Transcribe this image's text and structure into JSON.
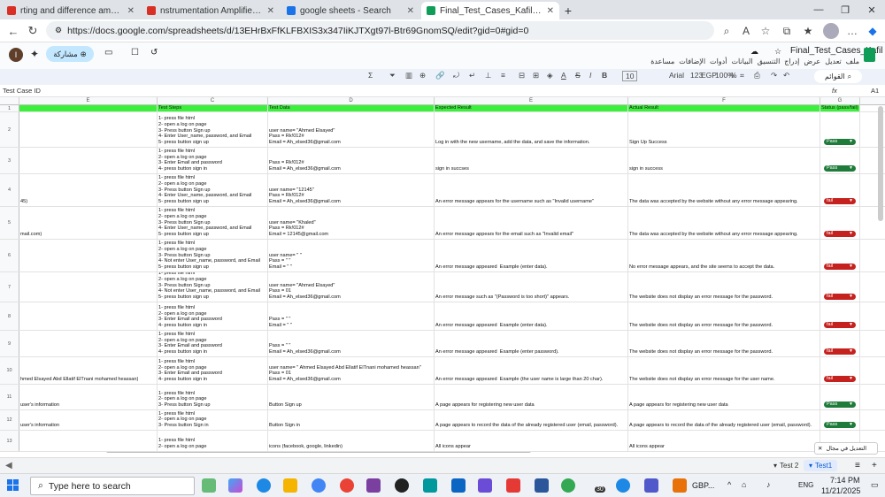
{
  "browser": {
    "tabs": [
      {
        "title": "rting and difference amp محاضرة",
        "icon_color": "#d93025",
        "active": false
      },
      {
        "title": "nstrumentation Amplifier محاضرة",
        "icon_color": "#d93025",
        "active": false
      },
      {
        "title": "google sheets - Search",
        "icon_color": "#1a73e8",
        "active": false
      },
      {
        "title": "Final_Test_Cases_Kafil - جداول بيانات",
        "icon_color": "#0f9d58",
        "active": true
      }
    ],
    "url": "https://docs.google.com/spreadsheets/d/13EHrBxFfKLFBXIS3x347IiKJTXgt97l-Btr69GnomSQ/edit?gid=0#gid=0"
  },
  "docs": {
    "title": "Final_Test_Cases_Kafil",
    "menu": [
      "ملف",
      "تعديل",
      "عرض",
      "إدراج",
      "التنسيق",
      "البيانات",
      "أدوات",
      "الإضافات",
      "مساعدة"
    ],
    "share_label": "مشاركة",
    "avatar_letter": "I",
    "menus_label": "القوائم",
    "zoom": "100%",
    "font": "Arial",
    "font_size": "10",
    "currency": "EGP",
    "number_format": "123",
    "cell_ref": "A1",
    "formula_value": "Test Case ID"
  },
  "grid": {
    "columns": [
      "E",
      "C",
      "D",
      "E",
      "F",
      "G"
    ],
    "header": {
      "steps": "Test Steps",
      "data": "Test Data",
      "expected": "Expected Result",
      "actual": "Actual Result",
      "status": "Status (pass/fail)"
    },
    "rows": [
      {
        "num": "2",
        "left": "",
        "steps": "1- press file html\n2- open a log on page\n3- Press button Sign up\n4- Enter User_name, password, and Email\n5- press button sign up",
        "data": "user name= \"Ahmed Elsayed\"\nPass = Rk!012#\nEmail = Ah_elsed36@gmail.com",
        "expected": "Log in with the new username, add the data, and save the information.",
        "actual": "Sign Up Success",
        "status": "Pass"
      },
      {
        "num": "3",
        "left": "",
        "steps": "1- press file html\n2- open a log on page\n3- Enter Email and password\n4- press button sign in",
        "data": "Pass = Rk!012#\nEmail = Ah_elsed36@gmail.com",
        "expected": "sign in succses",
        "actual": "sign in success",
        "status": "Pass"
      },
      {
        "num": "4",
        "left": "45)",
        "steps": "1- press file html\n2- open a log on page\n3- Press button Sign up\n4- Enter User_name, password, and Email\n5- press button sign up",
        "data": "user name= \"12145\"\nPass = Rk!012#\nEmail = Ah_elsed36@gmail.com",
        "expected": "An error message appears for the username such as \"Invalid username\"",
        "actual": "The data was accepted by the website without any error message appearing.",
        "status": "fail"
      },
      {
        "num": "5",
        "left": "mail.com)",
        "steps": "1- press file html\n2- open a log on page\n3- Press button Sign up\n4- Enter User_name, password, and Email\n5- press button sign up",
        "data": "user name= \"Khaled\"\nPass = Rk!012#\nEmail = 12145@gmail.com",
        "expected": "An error message appears for the email such as \"Invalid email\"",
        "actual": "The data was accepted by the website without any error message appearing.",
        "status": "fail"
      },
      {
        "num": "6",
        "left": "",
        "steps": "1- press file html\n2- open a log on page\n3- Press button Sign up\n4- Not enter User_name, password, and Email\n5- press button sign up",
        "data": "user name= \" \"\nPass = \" \"\nEmail = \" \"",
        "expected": "An error message appeared  Example (enter data).",
        "actual": "No error message appears, and the site seems to accept the data.",
        "status": "fail"
      },
      {
        "num": "7",
        "left": "",
        "steps": "1- press file html\n2- open a log on page\n3- Press button Sign up\n4- Not enter User_name, password, and Email\n5- press button sign up",
        "data": "user name= \"Ahmed Elsayed\"\nPass = 01\nEmail = Ah_elsed36@gmail.com",
        "expected": "An error message such as \"(Password is too short)\" appears.",
        "actual": "The website does not display an error message for the password.",
        "status": "fail"
      },
      {
        "num": "8",
        "left": "",
        "steps": "1- press file html\n2- open a log on page\n3- Enter Email and password\n4- press button sign in",
        "data": "Pass = \" \"\nEmail = \" \"",
        "expected": "An error message appeared  Example (enter data).",
        "actual": "The website does not display an error message for the password.",
        "status": "fail"
      },
      {
        "num": "9",
        "left": "",
        "steps": "1- press file html\n2- open a log on page\n3- Enter Email and password\n4- press button sign in",
        "data": "Pass = \" \"\nEmail = Ah_elsed36@gmail.com",
        "expected": "An error message appeared  Example (enter password).",
        "actual": "The website does not display an error message for the password.",
        "status": "fail"
      },
      {
        "num": "10",
        "left": "hmed Elsayed Abd Ellatif ElTnani mohamed heassan)",
        "steps": "1- press file html\n2- open a log on page\n3- Enter Email and password\n4- press button sign in",
        "data": "user name= \" Ahmed Elsayed Abd Ellatif ElTnani mohamed heassan\"\nPass = 01\nEmail = Ah_elsed36@gmail.com",
        "expected": "An error message appeared  Example (the user name is large than 20 char).",
        "actual": "The website does not display an error message for the user name.",
        "status": "fail"
      },
      {
        "num": "11",
        "left": "user's information",
        "steps": "1- press file html\n2- open a log on page\n3- Press button Sign up",
        "data": "Button Sign up",
        "expected": "A page appears for registering new user data",
        "actual": "A page appears for registering new user data",
        "status": "Pass"
      },
      {
        "num": "12",
        "left": "user's information",
        "steps": "1- press file html\n2- open a log on page\n3- Press button Sign in",
        "data": "Button Sign in",
        "expected": "A page appears to record the data of the already registered user (email, password).",
        "actual": "A page appears to record the data of the already registered user (email, password).",
        "status": "Pass"
      },
      {
        "num": "13",
        "left": "",
        "steps": "1- press file html\n2- open a log on page",
        "data": "icons (facebook, google, linkedin)",
        "expected": "All icons appear",
        "actual": "All icons appear",
        "status": ""
      }
    ]
  },
  "sheets": {
    "tabs": [
      "Test1",
      "Test 2"
    ],
    "active": "Test1"
  },
  "side_popup": "التعديل في مجال",
  "taskbar": {
    "search_placeholder": "Type here to search",
    "weather": "GBP...",
    "language": "ENG",
    "time": "7:14 PM",
    "date": "11/21/2025",
    "badge": "30"
  }
}
